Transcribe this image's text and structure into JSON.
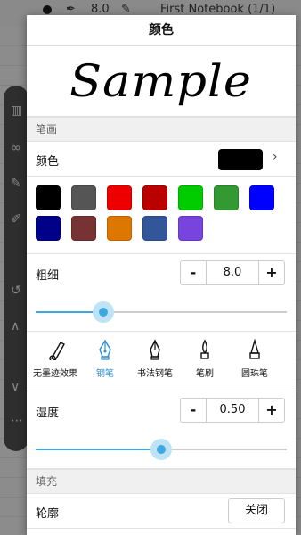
{
  "background": {
    "size_value": "8.0",
    "notebook_title": "First Notebook (1/1)"
  },
  "dialog": {
    "title": "颜色",
    "sample_text": "Sample",
    "stroke_section": "笔画",
    "color_label": "颜色",
    "current_color": "#000000",
    "palette": [
      "#000000",
      "#555555",
      "#ee0000",
      "#bb0000",
      "#00cc00",
      "#339933",
      "#0000ff",
      "#000088",
      "#773333",
      "#dd7700",
      "#335599",
      "#7744dd"
    ],
    "thickness": {
      "label": "粗细",
      "value": "8.0",
      "minus": "-",
      "plus": "+",
      "slider_fraction": 0.27
    },
    "pens": [
      {
        "label": "无墨迹效果",
        "icon": "no-ink-pen-icon",
        "active": false
      },
      {
        "label": "钢笔",
        "icon": "fountain-pen-icon",
        "active": true
      },
      {
        "label": "书法钢笔",
        "icon": "calligraphy-pen-icon",
        "active": false
      },
      {
        "label": "笔刷",
        "icon": "brush-icon",
        "active": false
      },
      {
        "label": "圆珠笔",
        "icon": "ballpoint-pen-icon",
        "active": false
      }
    ],
    "wetness": {
      "label": "湿度",
      "value": "0.50",
      "minus": "-",
      "plus": "+",
      "slider_fraction": 0.5
    },
    "fill_section": "填充",
    "outline": {
      "label": "轮廓",
      "button": "关闭"
    }
  },
  "colors": {
    "accent": "#3fa7df"
  }
}
